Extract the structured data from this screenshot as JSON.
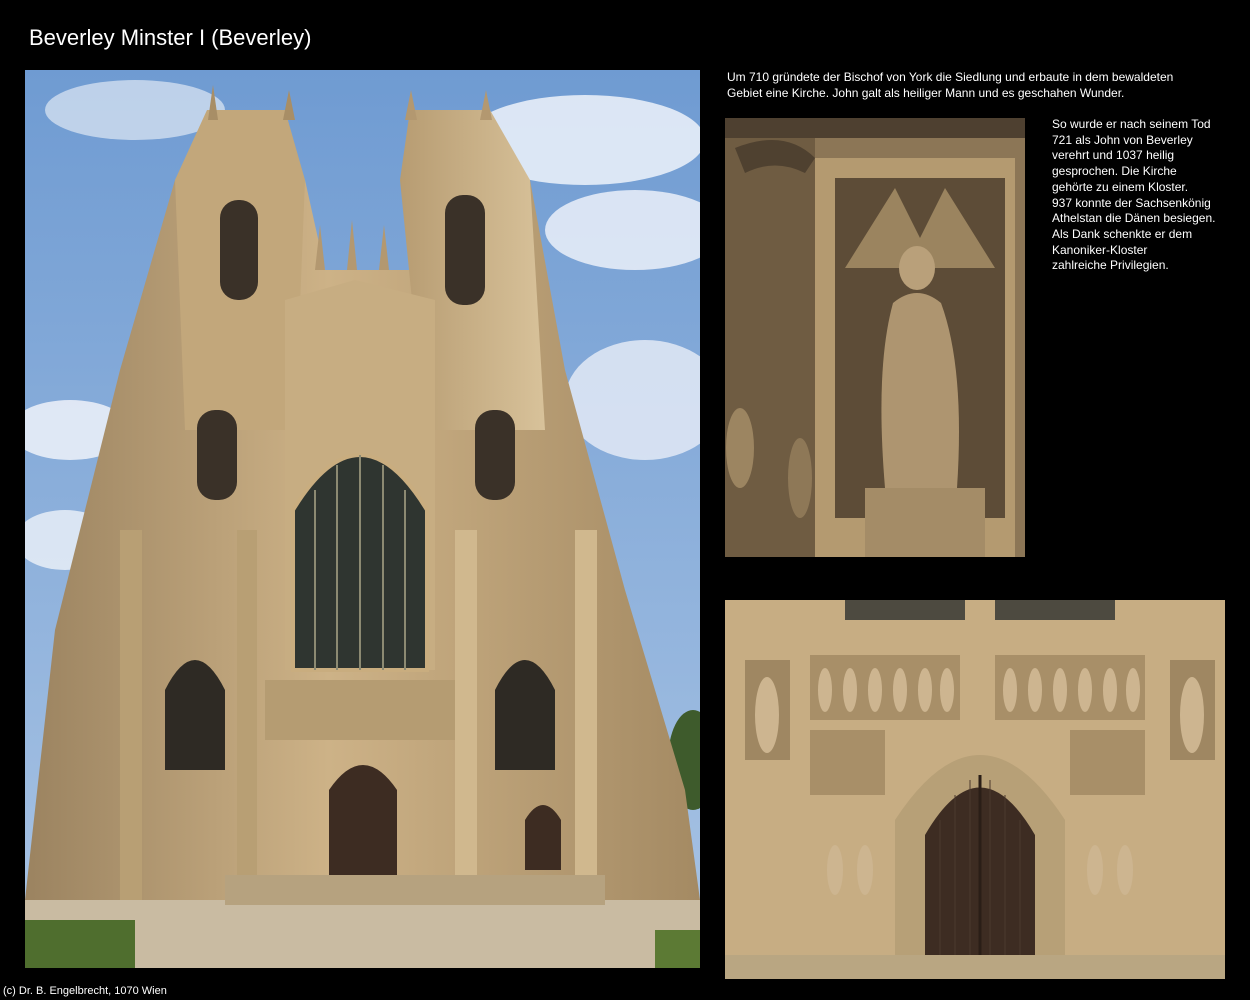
{
  "page": {
    "title": "Beverley Minster I (Beverley)"
  },
  "texts": {
    "intro": "Um 710 gründete der Bischof von York die Siedlung und erbaute in dem bewaldeten\nGebiet eine Kirche. John galt als heiliger Mann und es geschahen Wunder.",
    "history": "So wurde er nach seinem Tod\n721 als John von Beverley\nverehrt und 1037 heilig\ngesprochen. Die Kirche\ngehörte zu einem Kloster.\n937 konnte der Sachsenkönig\nAthelstan die Dänen besiegen.\nAls Dank schenkte er dem\nKanoniker-Kloster\nzahlreiche Privilegien."
  },
  "footer": {
    "copyright": "(c) Dr. B. Engelbrecht, 1070 Wien"
  },
  "colors": {
    "background": "#000000",
    "sky": "#7fa7d6",
    "stone": "#c9ad7f",
    "door": "#3d2c22"
  }
}
